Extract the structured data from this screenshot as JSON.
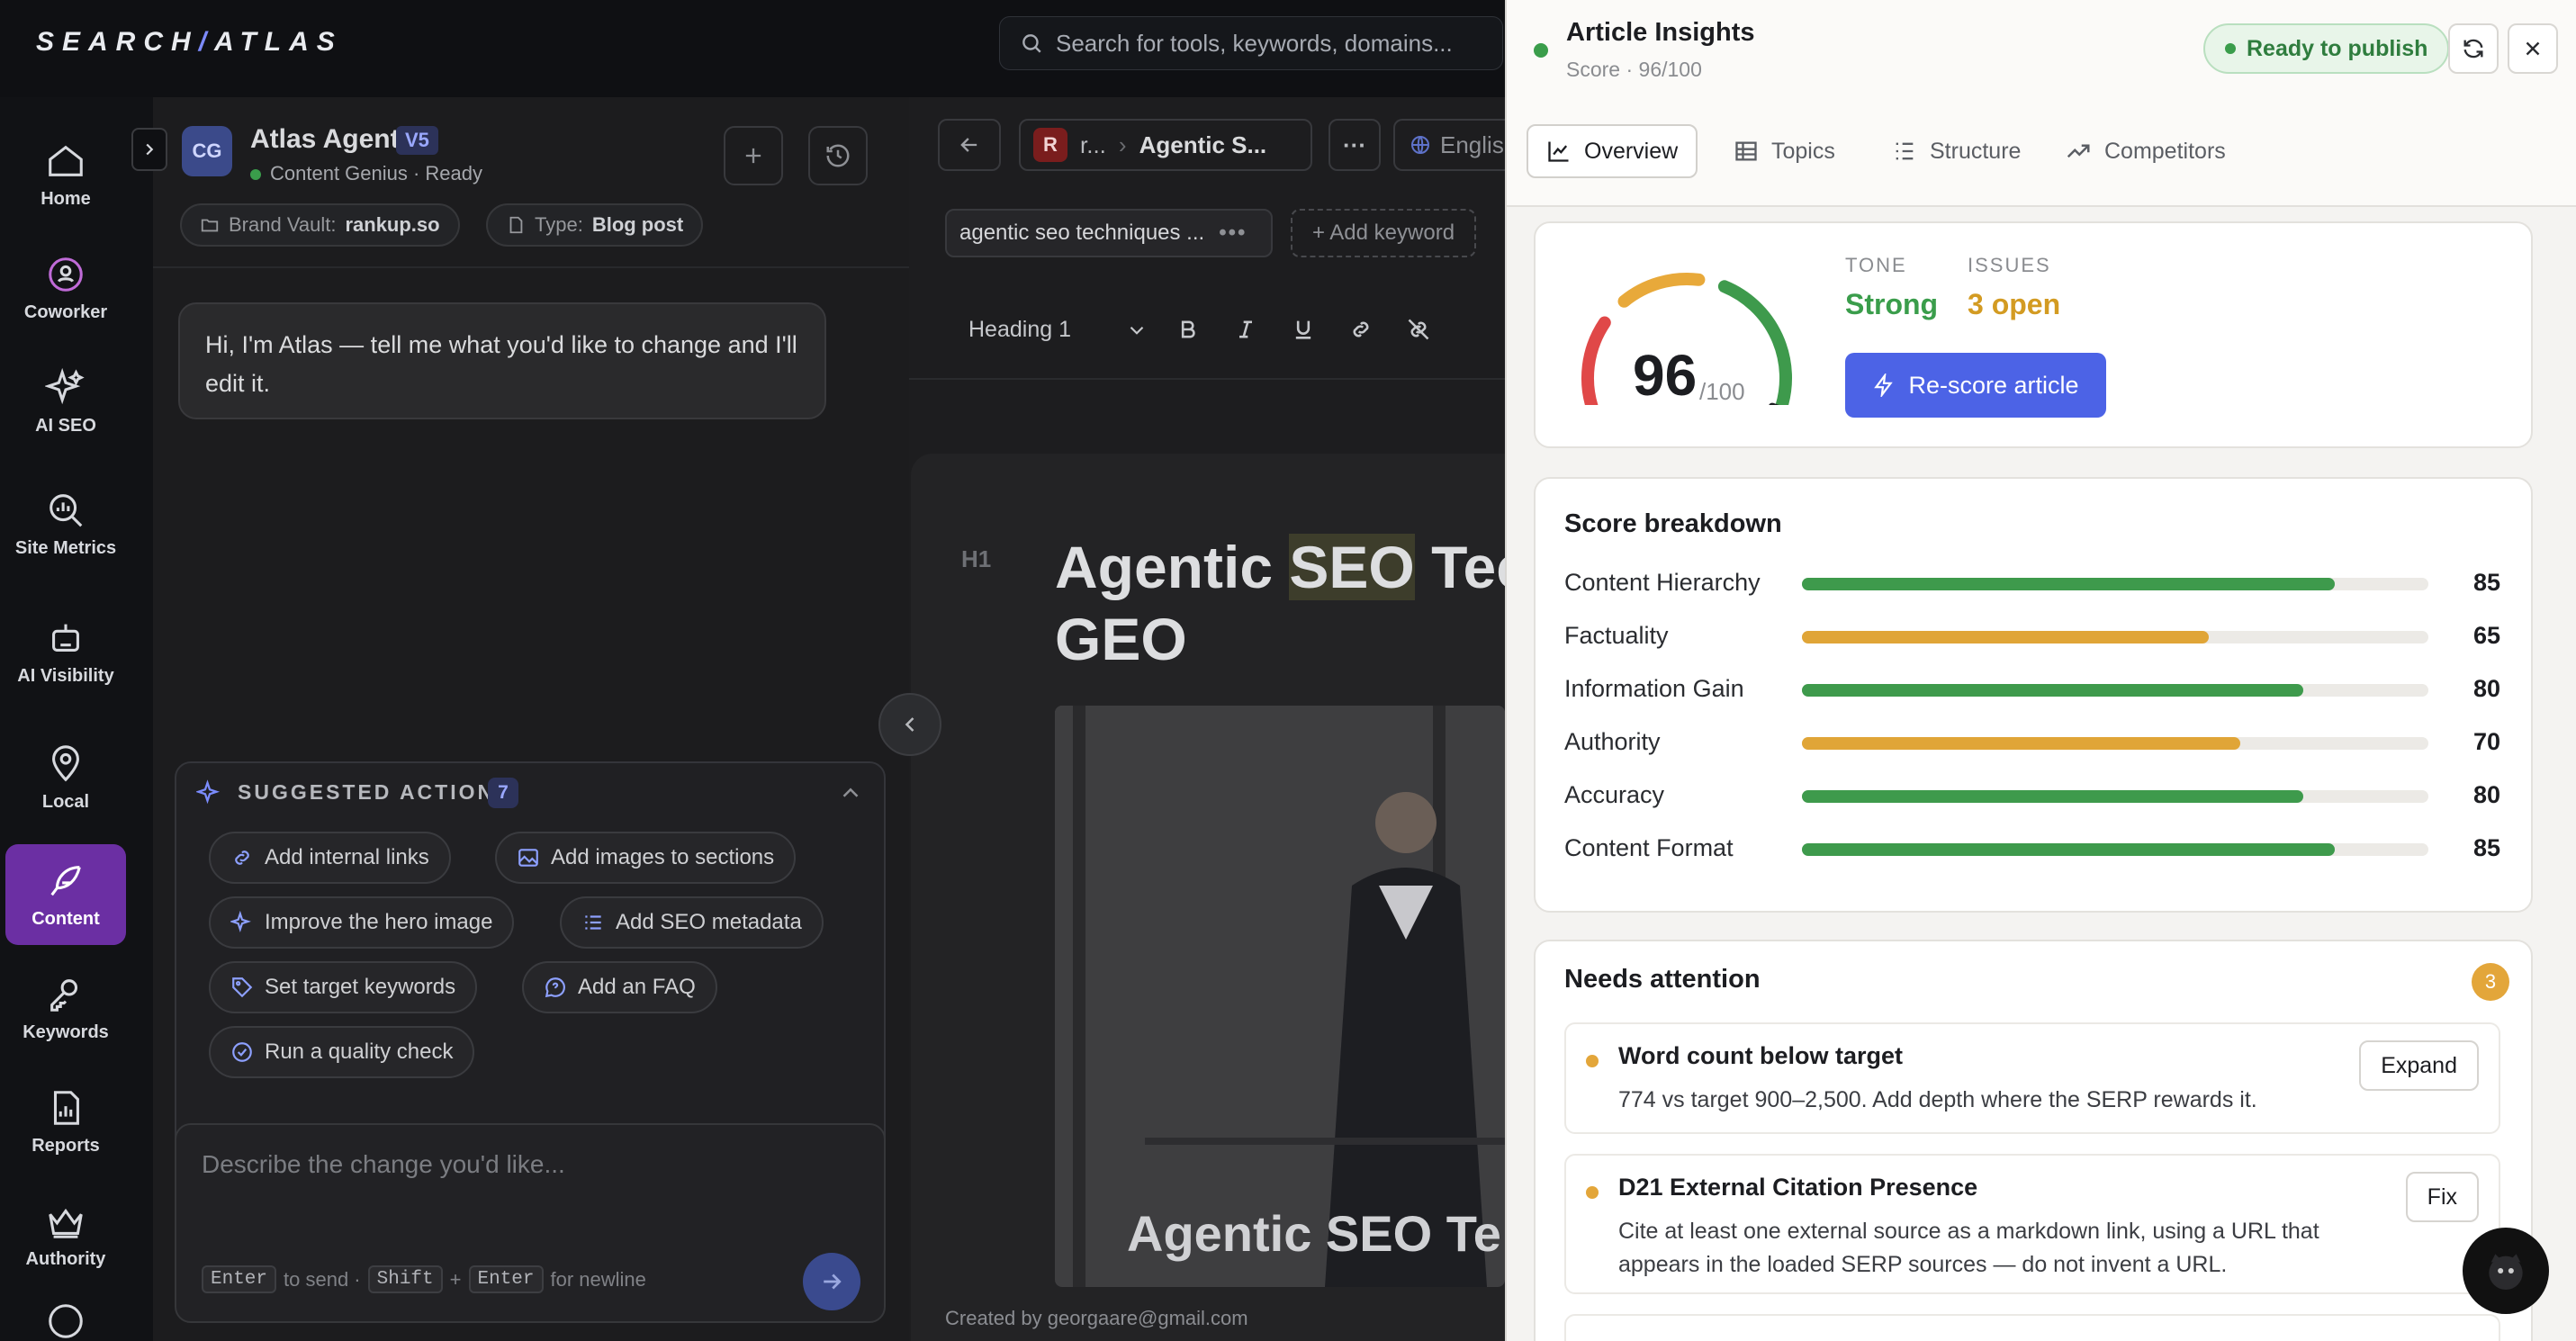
{
  "topbar": {
    "logo_left": "SEARCH",
    "logo_slash": "/",
    "logo_right": "ATLAS",
    "search_placeholder": "Search for tools, keywords, domains..."
  },
  "leftnav": {
    "items": [
      {
        "label": "Home",
        "icon": "home-icon"
      },
      {
        "label": "Coworker",
        "icon": "coworker-icon"
      },
      {
        "label": "AI SEO",
        "icon": "sparkles-icon"
      },
      {
        "label": "Site Metrics",
        "icon": "magnifier-chart-icon"
      },
      {
        "label": "AI Visibility",
        "icon": "robot-icon"
      },
      {
        "label": "Local",
        "icon": "location-pin-icon"
      },
      {
        "label": "Content",
        "icon": "feather-pen-icon"
      },
      {
        "label": "Keywords",
        "icon": "key-icon"
      },
      {
        "label": "Reports",
        "icon": "report-icon"
      },
      {
        "label": "Authority",
        "icon": "crown-icon"
      }
    ],
    "active": "Content"
  },
  "agent": {
    "avatar": "CG",
    "name": "Atlas Agent",
    "version": "V5",
    "status": "Content Genius · Ready",
    "brand_vault_label": "Brand Vault:",
    "brand_vault_value": "rankup.so",
    "type_label": "Type:",
    "type_value": "Blog post",
    "greeting": "Hi, I'm Atlas — tell me what you'd like to change and I'll edit it.",
    "suggested_title": "SUGGESTED ACTIONS",
    "suggested_count": "7",
    "actions": [
      "Add internal links",
      "Add images to sections",
      "Improve the hero image",
      "Add SEO metadata",
      "Set target keywords",
      "Add an FAQ",
      "Run a quality check"
    ],
    "composer_placeholder": "Describe the change you'd like...",
    "hint_enter": "Enter",
    "hint_to_send": "to send ·",
    "hint_shift": "Shift",
    "hint_plus": "+",
    "hint_enter2": "Enter",
    "hint_newline": "for newline"
  },
  "editor": {
    "doc_avatar": "R",
    "breadcrumb_short": "r...",
    "doc_title": "Agentic S...",
    "more": "···",
    "language": "Englis",
    "keyword_chip": "agentic seo techniques ...",
    "add_keyword": "+ Add keyword",
    "style_select": "Heading 1",
    "h1_tag": "H1",
    "heading_pre": "Agentic ",
    "heading_highlight": "SEO",
    "heading_post": " Tec",
    "heading_line2": "GEO",
    "hero_text": "Agentic SEO Te",
    "created_by": "Created by georgaare@gmail.com"
  },
  "insights": {
    "title": "Article Insights",
    "subtitle": "Score · 96/100",
    "ready_badge": "Ready to publish",
    "tabs": [
      {
        "label": "Overview",
        "icon": "line-chart-icon"
      },
      {
        "label": "Topics",
        "icon": "grid-icon"
      },
      {
        "label": "Structure",
        "icon": "list-numbered-icon"
      },
      {
        "label": "Competitors",
        "icon": "trending-up-icon"
      }
    ],
    "score": "96",
    "score_den": "/100",
    "score_value": 96,
    "tone_label": "TONE",
    "tone_value": "Strong",
    "issues_label": "ISSUES",
    "issues_value": "3 open",
    "rescore_label": "Re-score article",
    "breakdown_title": "Score breakdown",
    "breakdown": [
      {
        "label": "Content Hierarchy",
        "value": "85",
        "pct": 85,
        "color": "#3e9a4c"
      },
      {
        "label": "Factuality",
        "value": "65",
        "pct": 65,
        "color": "#e0a537"
      },
      {
        "label": "Information Gain",
        "value": "80",
        "pct": 80,
        "color": "#3e9a4c"
      },
      {
        "label": "Authority",
        "value": "70",
        "pct": 70,
        "color": "#e0a537"
      },
      {
        "label": "Accuracy",
        "value": "80",
        "pct": 80,
        "color": "#3e9a4c"
      },
      {
        "label": "Content Format",
        "value": "85",
        "pct": 85,
        "color": "#3e9a4c"
      }
    ],
    "attention_title": "Needs attention",
    "attention_count": "3",
    "issues": [
      {
        "title": "Word count below target",
        "desc": "774 vs target 900–2,500. Add depth where the SERP rewards it.",
        "action": "Expand"
      },
      {
        "title": "D21 External Citation Presence",
        "desc": "Cite at least one external source as a markdown link, using a URL that appears in the loaded SERP sources — do not invent a URL.",
        "action": "Fix"
      }
    ]
  }
}
